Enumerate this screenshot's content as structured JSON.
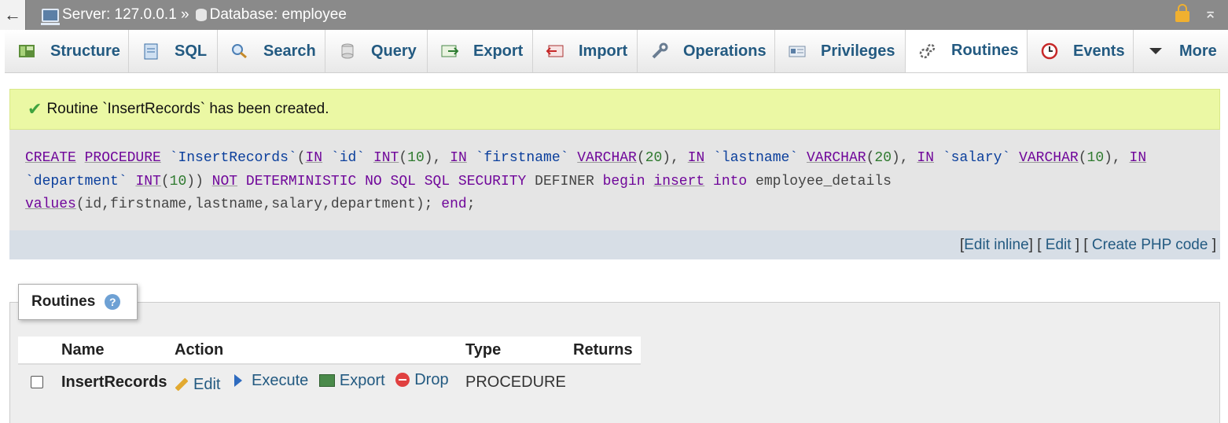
{
  "topbar": {
    "back": "←",
    "server": "Server: 127.0.0.1 »",
    "database": "Database: employee"
  },
  "tabs": [
    {
      "label": "Structure",
      "icon": "structure-icon"
    },
    {
      "label": "SQL",
      "icon": "sql-icon"
    },
    {
      "label": "Search",
      "icon": "search-icon"
    },
    {
      "label": "Query",
      "icon": "query-icon"
    },
    {
      "label": "Export",
      "icon": "export-icon"
    },
    {
      "label": "Import",
      "icon": "import-icon"
    },
    {
      "label": "Operations",
      "icon": "wrench-icon"
    },
    {
      "label": "Privileges",
      "icon": "privileges-icon"
    },
    {
      "label": "Routines",
      "icon": "routines-icon",
      "active": true
    },
    {
      "label": "Events",
      "icon": "clock-icon"
    },
    {
      "label": "More",
      "icon": "caret-down-icon"
    }
  ],
  "message": {
    "success": "Routine `InsertRecords` has been created."
  },
  "sql": {
    "line1_parts": [
      "CREATE",
      "PROCEDURE",
      "`InsertRecords`",
      "(",
      "IN",
      "`id`",
      "INT",
      "10",
      "IN",
      "`firstname`",
      "VARCHAR",
      "20",
      "IN",
      "`lastname`",
      "VARCHAR",
      "20",
      "IN",
      "`salary`",
      "VARCHAR",
      "10",
      "IN"
    ],
    "links": {
      "edit_inline": "Edit inline",
      "edit": "Edit",
      "create_php": "Create PHP code"
    }
  },
  "routines": {
    "legend": "Routines",
    "headers": {
      "name": "Name",
      "action": "Action",
      "type": "Type",
      "returns": "Returns"
    },
    "rows": [
      {
        "name": "InsertRecords",
        "actions": {
          "edit": "Edit",
          "execute": "Execute",
          "export": "Export",
          "drop": "Drop"
        },
        "type": "PROCEDURE",
        "returns": ""
      }
    ]
  },
  "colors": {
    "link": "#235a81",
    "success_bg": "#ebf8a4",
    "sql_keyword": "#70079a",
    "topbar": "#8a8a8a"
  }
}
